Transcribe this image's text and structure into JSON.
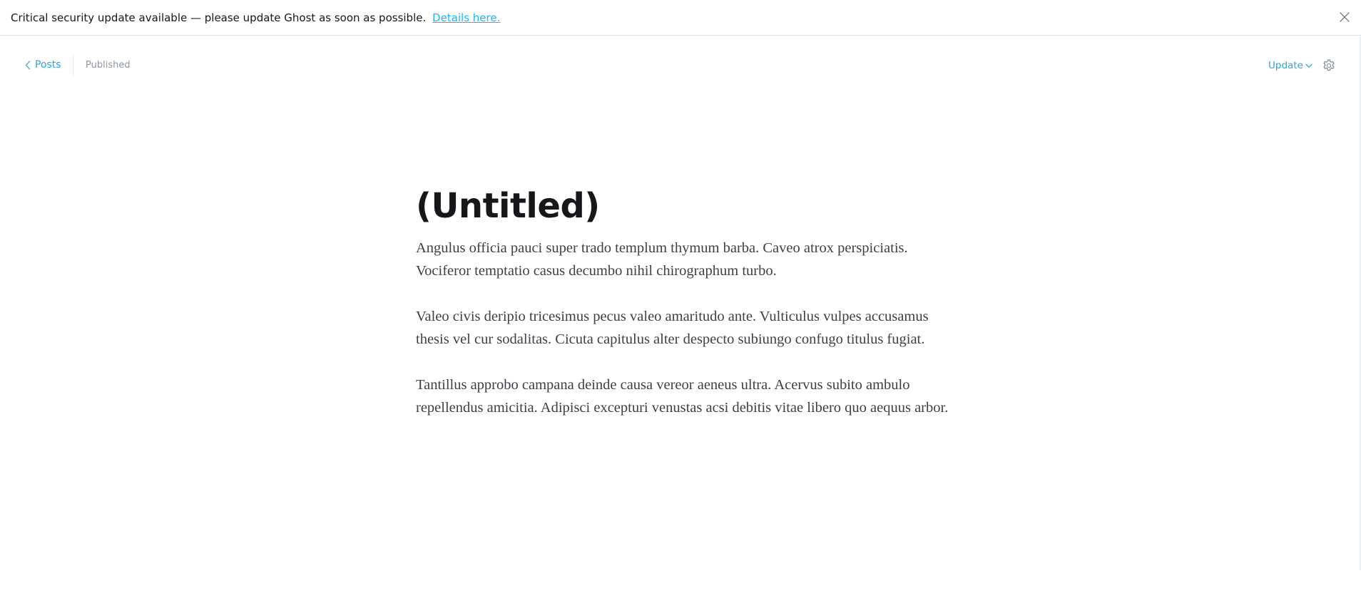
{
  "alert": {
    "message": "Critical security update available — please update Ghost as soon as possible.",
    "link_label": "Details here."
  },
  "header": {
    "back_label": "Posts",
    "status": "Published",
    "update_label": "Update"
  },
  "post": {
    "title": "(Untitled)",
    "paragraphs": [
      {
        "line1": "Angulus officia pauci super trado templum thymum barba. Caveo atrox perspiciatis.",
        "line2": "Vociferor temptatio casus decumbo nihil chirographum turbo."
      },
      {
        "line1": "Valeo civis deripio tricesimus pecus valeo amaritudo ante. Vulticulus vulpes accusamus",
        "line2": "thesis vel cur sodalitas. Cicuta capitulus alter despecto subiungo confugo titulus fugiat."
      },
      {
        "line1": "Tantillus approbo campana deinde causa vereor aeneus ultra. Acervus subito ambulo",
        "line2": "repellendus amicitia. Adipisci excepturi venustas acsi debitis vitae libero quo aequus arbor."
      }
    ]
  },
  "colors": {
    "accent": "#2aa7d9",
    "link": "#14b8ff",
    "title": "#15171a",
    "body_text": "#3a4149",
    "muted": "#8c97a3"
  },
  "icons": {
    "alert_close": "close-icon",
    "back": "chevron-left-icon",
    "update_dropdown": "chevron-down-icon",
    "settings": "gear-icon"
  }
}
